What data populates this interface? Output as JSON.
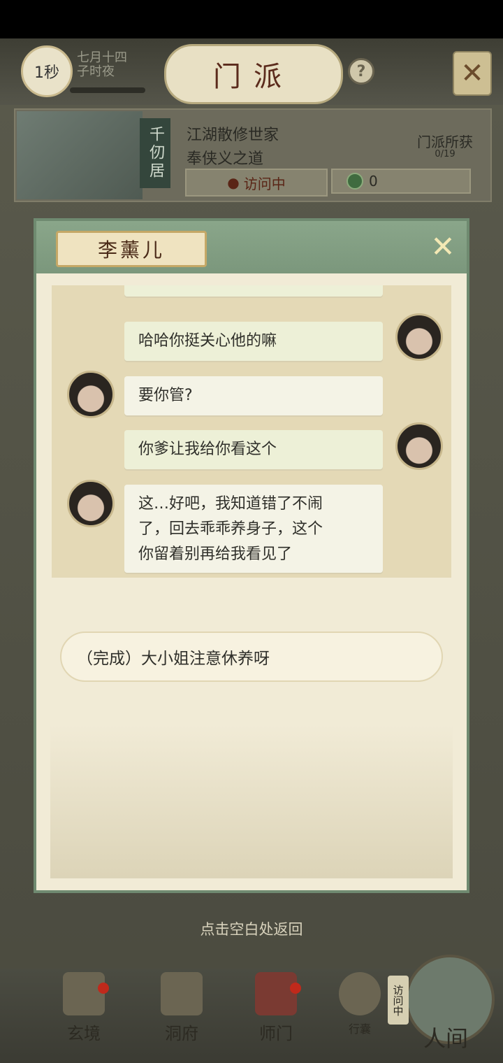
{
  "header": {
    "timer": "1秒",
    "date_line1": "七月十四",
    "date_line2": "子时夜",
    "title": "门派",
    "help": "?"
  },
  "sect": {
    "tag": "千仞居",
    "line1": "江湖散修世家",
    "line2": "奉侠义之道",
    "status": "访问中",
    "coins": "0",
    "gain_label": "门派所获",
    "gain_count": "0/19"
  },
  "dialog": {
    "name": "李薰儿",
    "messages": [
      {
        "speaker": "male",
        "text": "哈哈你挺关心他的嘛"
      },
      {
        "speaker": "female",
        "text": "要你管?"
      },
      {
        "speaker": "male",
        "text": "你爹让我给你看这个"
      },
      {
        "speaker": "female",
        "line1": "这…好吧，我知道错了不闹",
        "line2": "了，回去乖乖养身子，这个",
        "line3": "你留着别再给我看见了"
      }
    ],
    "choice": "（完成）大小姐注意休养呀"
  },
  "hint": "点击空白处返回",
  "nav": {
    "items": [
      "玄境",
      "洞府",
      "师门",
      "行囊"
    ],
    "visiting": "访问中",
    "world": "人间"
  }
}
